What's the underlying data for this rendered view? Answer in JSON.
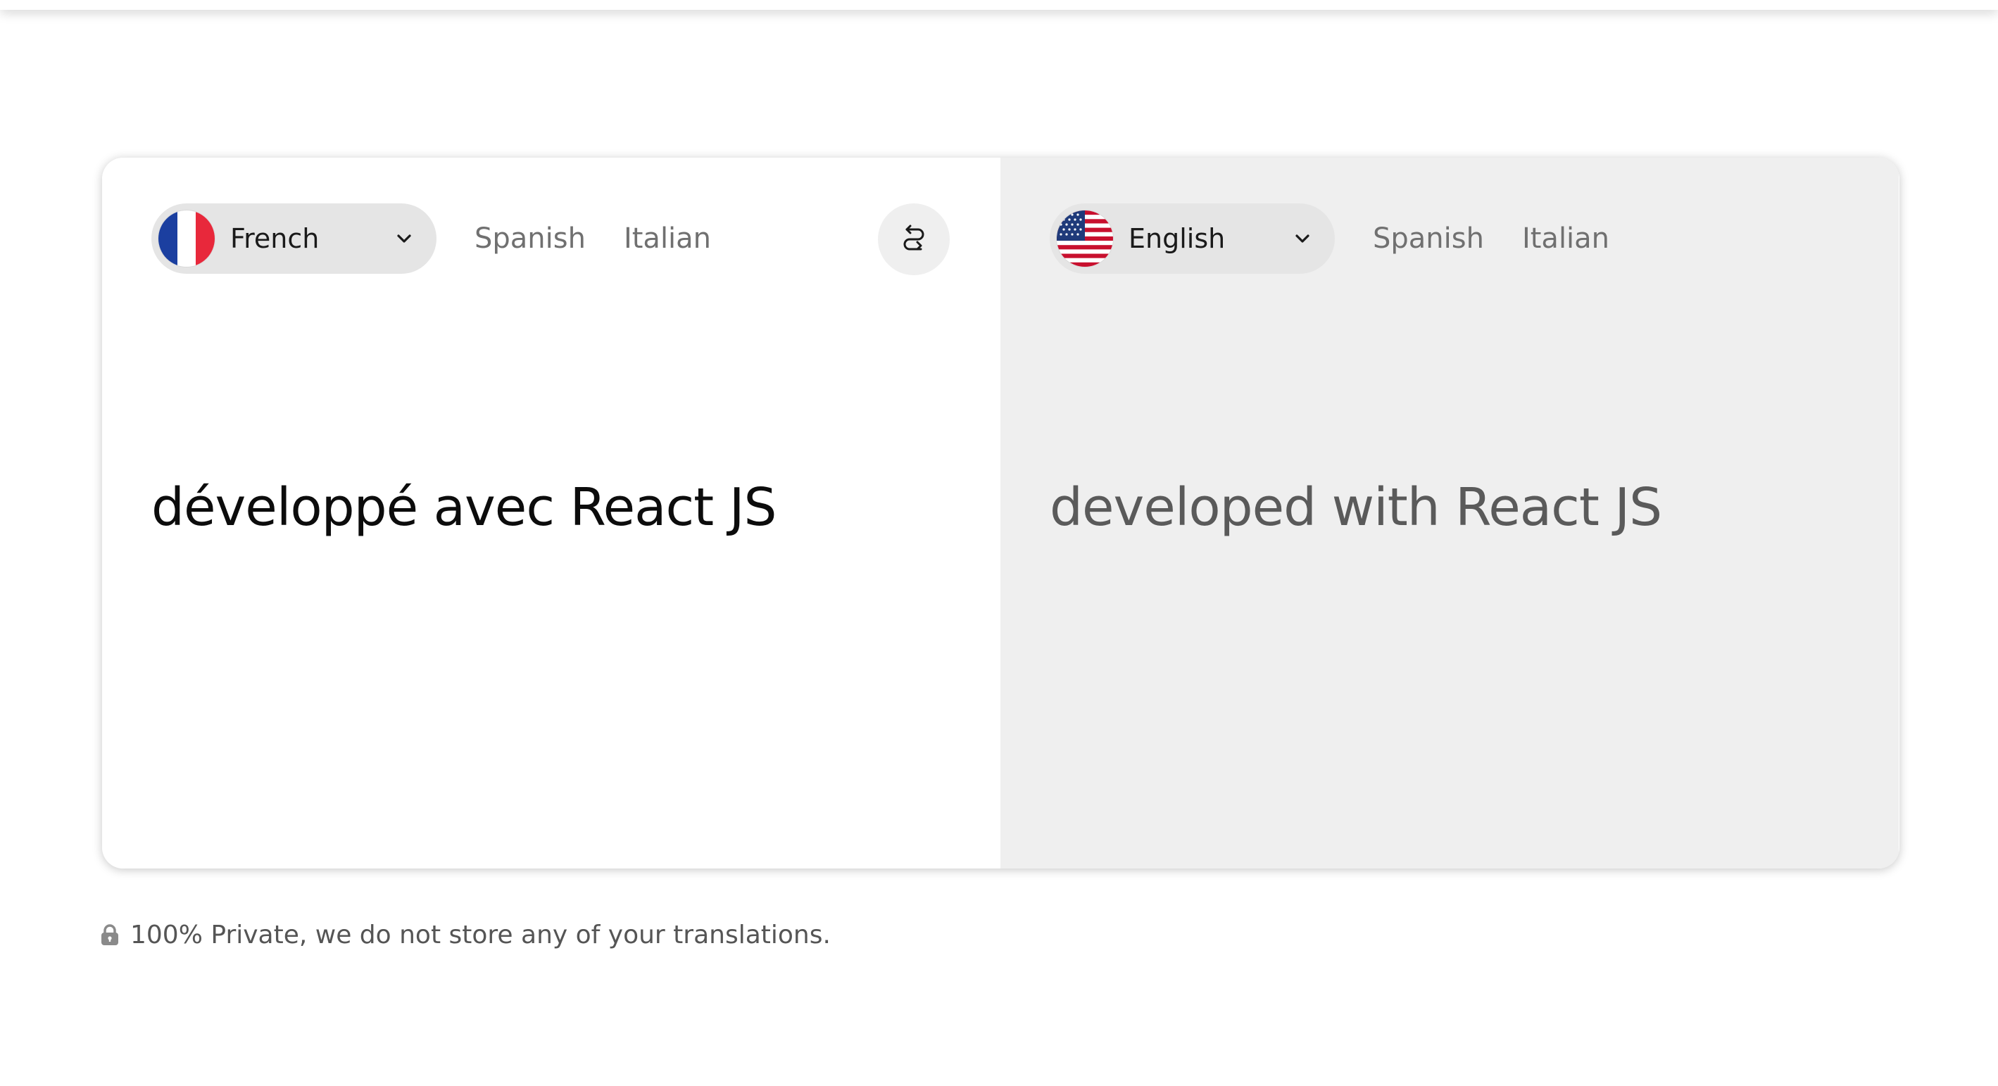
{
  "source_panel": {
    "selected_language": "French",
    "flag_icon": "france-flag-icon",
    "quick_languages": [
      "Spanish",
      "Italian"
    ],
    "text": "développé avec React JS"
  },
  "swap_button": {
    "icon": "swap-arrows-icon"
  },
  "target_panel": {
    "selected_language": "English",
    "flag_icon": "usa-flag-icon",
    "quick_languages": [
      "Spanish",
      "Italian"
    ],
    "text": "developed with React JS"
  },
  "footer": {
    "privacy_icon": "lock-icon",
    "privacy_text": "100% Private, we do not store any of your translations."
  },
  "colors": {
    "source_bg": "#ffffff",
    "target_bg": "#efefef",
    "select_bg": "#e5e5e5",
    "muted_text": "#707070"
  }
}
